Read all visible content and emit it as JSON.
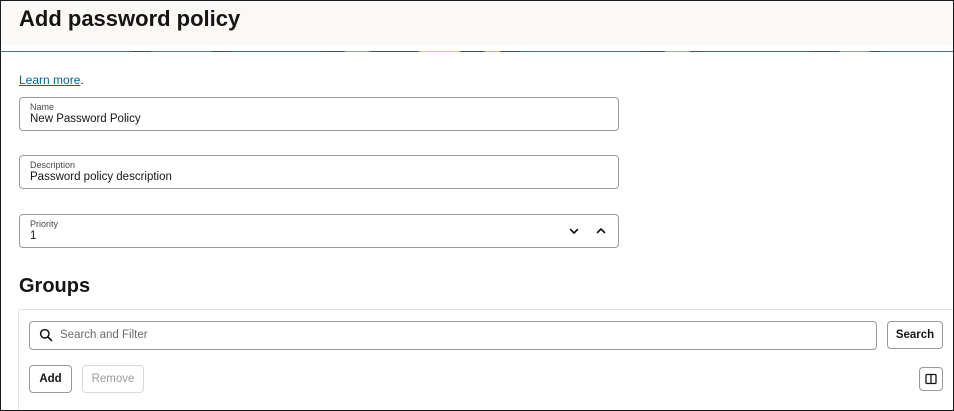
{
  "header": {
    "title": "Add password policy"
  },
  "intro": {
    "learn_more": "Learn more",
    "punctuation": "."
  },
  "form": {
    "name": {
      "label": "Name",
      "value": "New Password Policy"
    },
    "description": {
      "label": "Description",
      "value": "Password policy description"
    },
    "priority": {
      "label": "Priority",
      "value": "1",
      "decrement_icon": "chevron-down-icon",
      "increment_icon": "chevron-up-icon"
    }
  },
  "groups": {
    "title": "Groups",
    "search_placeholder": "Search and Filter",
    "search_button": "Search",
    "add_button": "Add",
    "remove_button": "Remove",
    "column_toggle_icon": "columns-icon"
  },
  "colors": {
    "link": "#00688c",
    "banner_green": "#3f7d5a",
    "banner_dark": "#2f5d45",
    "banner_yellow": "#e8c46a",
    "border": "#9e9892"
  }
}
